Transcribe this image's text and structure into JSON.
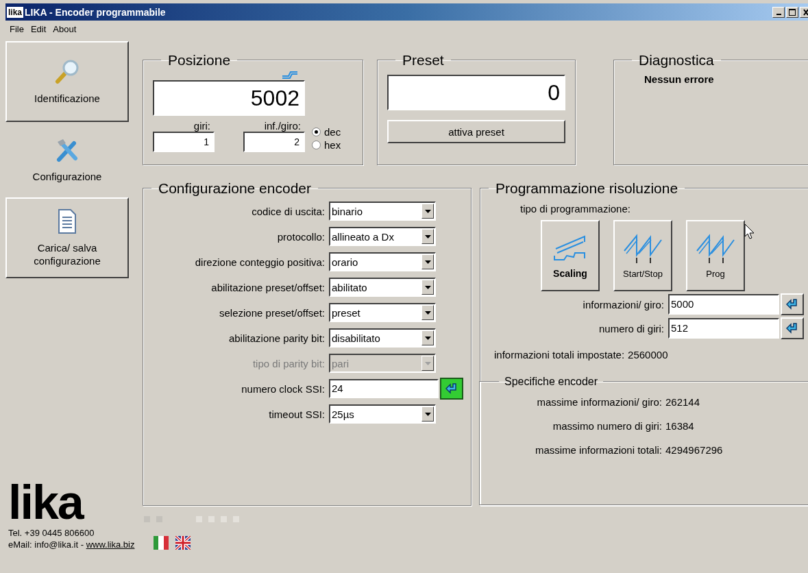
{
  "window": {
    "icon_text": "lika",
    "title": "LIKA - Encoder programmabile"
  },
  "menu": [
    "File",
    "Edit",
    "About"
  ],
  "sidebar": {
    "items": [
      {
        "kind": "identify",
        "label": "Identificazione",
        "selected": false
      },
      {
        "kind": "configure",
        "label": "Configurazione",
        "selected": true
      },
      {
        "kind": "file",
        "label": "Carica/ salva configurazione",
        "selected": false
      }
    ]
  },
  "position": {
    "title": "Posizione",
    "value": "5002",
    "turns_label": "giri:",
    "turns": "1",
    "info_label": "inf./giro:",
    "info": "2",
    "radix": [
      {
        "label": "dec",
        "selected": true
      },
      {
        "label": "hex",
        "selected": false
      }
    ]
  },
  "preset": {
    "title": "Preset",
    "value": "0",
    "button": "attiva preset"
  },
  "diagnostics": {
    "title": "Diagnostica",
    "message": "Nessun errore"
  },
  "encoder_config": {
    "title": "Configurazione encoder",
    "fields": [
      {
        "kind": "select",
        "label": "codice di uscita:",
        "value": "binario",
        "disabled": false
      },
      {
        "kind": "select",
        "label": "protocollo:",
        "value": "allineato a Dx",
        "disabled": false
      },
      {
        "kind": "select",
        "label": "direzione conteggio positiva:",
        "value": "orario",
        "disabled": false
      },
      {
        "kind": "select",
        "label": "abilitazione preset/offset:",
        "value": "abilitato",
        "disabled": false
      },
      {
        "kind": "select",
        "label": "selezione preset/offset:",
        "value": "preset",
        "disabled": false
      },
      {
        "kind": "select",
        "label": "abilitazione parity bit:",
        "value": "disabilitato",
        "disabled": false
      },
      {
        "kind": "select",
        "label": "tipo di parity bit:",
        "value": "pari",
        "disabled": true
      },
      {
        "kind": "input",
        "label": "numero clock SSI:",
        "value": "24",
        "pending": true
      },
      {
        "kind": "select",
        "label": "timeout SSI:",
        "value": "25µs",
        "disabled": false
      }
    ]
  },
  "resolution": {
    "title": "Programmazione risoluzione",
    "type_label": "tipo di programmazione:",
    "types": [
      {
        "kind": "scaling",
        "label": "Scaling",
        "selected": true
      },
      {
        "kind": "startstop",
        "label": "Start/Stop",
        "selected": false
      },
      {
        "kind": "prog",
        "label": "Prog",
        "selected": false
      }
    ],
    "fields": [
      {
        "label": "informazioni/ giro:",
        "value": "5000",
        "pending": false
      },
      {
        "label": "numero di giri:",
        "value": "512",
        "pending": false
      }
    ],
    "total_label": "informazioni totali impostate:",
    "total": "2560000",
    "specs": {
      "title": "Specifiche encoder",
      "rows": [
        {
          "label": "massime informazioni/ giro:",
          "value": "262144"
        },
        {
          "label": "massimo numero di giri:",
          "value": "16384"
        },
        {
          "label": "massime informazioni totali:",
          "value": "4294967296"
        }
      ]
    }
  },
  "footer": {
    "logo": "lika",
    "phone": "Tel. +39 0445 806600",
    "email": "eMail: info@lika.it - ",
    "website": "www.lika.biz",
    "flags": [
      {
        "kind": "italian"
      },
      {
        "kind": "uk"
      }
    ]
  }
}
